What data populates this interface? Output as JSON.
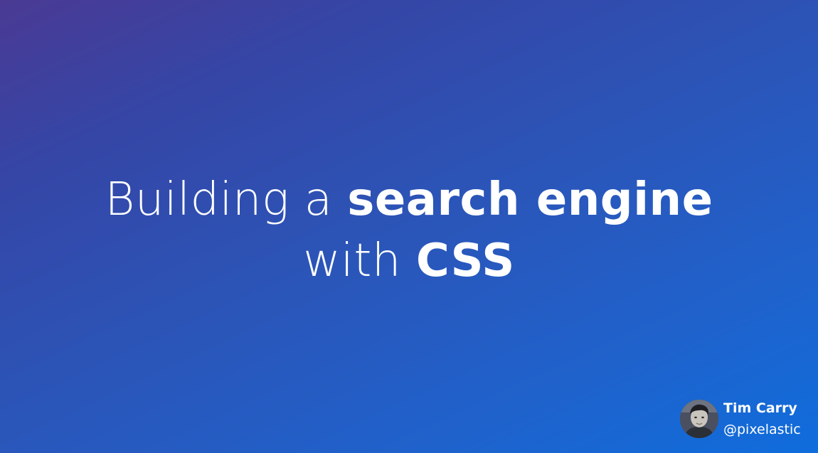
{
  "title": {
    "line1_regular": "Building a ",
    "line1_bold": "search engine",
    "line2_regular": "with ",
    "line2_bold": "CSS"
  },
  "author": {
    "name": "Tim Carry",
    "handle": "@pixelastic",
    "avatar_icon": "author-photo"
  },
  "colors": {
    "background_gradient": [
      "#4a3a94",
      "#2b55b8",
      "#0f6ddc"
    ],
    "text": "#ffffff"
  }
}
